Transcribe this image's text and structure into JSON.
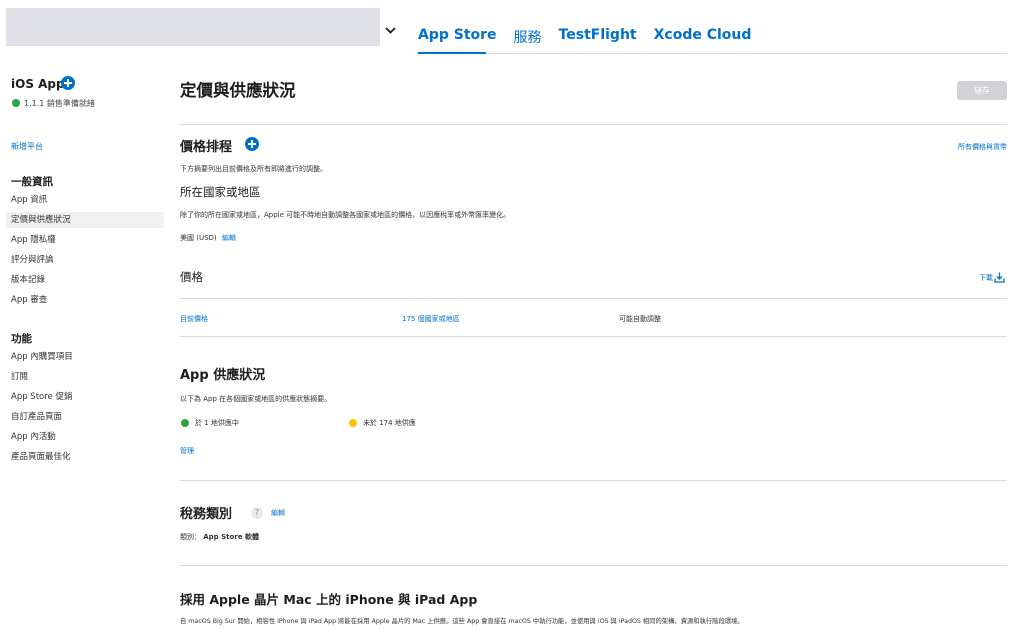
{
  "header": {
    "tabs": [
      {
        "label": "App Store",
        "active": true
      },
      {
        "label": "服務",
        "active": false
      },
      {
        "label": "TestFlight",
        "active": false
      },
      {
        "label": "Xcode Cloud",
        "active": false
      }
    ]
  },
  "sidebar": {
    "app_name": "iOS App",
    "status": "1.1.1 銷售準備就緒",
    "add_platform": "新增平台",
    "general_heading": "一般資訊",
    "general_items": [
      "App 資訊",
      "定價與供應狀況",
      "App 隱私權",
      "評分與評論",
      "版本記錄",
      "App 審查"
    ],
    "features_heading": "功能",
    "features_items": [
      "App 內購買項目",
      "訂閱",
      "App Store 促銷",
      "自訂產品頁面",
      "App 內活動",
      "產品頁面最佳化"
    ]
  },
  "main": {
    "title": "定價與供應狀況",
    "save_label": "儲存",
    "schedule": {
      "title": "價格排程",
      "all_prices_link": "所有價格與貨幣",
      "desc": "下方摘要列出目前價格及所有即將進行的調整。",
      "base_region_title": "所在國家或地區",
      "base_region_desc": "除了你的所在國家或地區，Apple 可能不時地自動調整各國家或地區的價格，以因應稅率或外幣匯率變化。",
      "currency": "美國 (USD)",
      "edit_label": "編輯"
    },
    "price": {
      "title": "價格",
      "download_label": "下載",
      "current_price_label": "目前價格",
      "regions_link": "175 個國家或地區",
      "auto_adjust": "可能自動調整"
    },
    "availability": {
      "title": "App 供應狀況",
      "desc": "以下為 App 在各個國家或地區的供應狀態摘要。",
      "available": "於 1 地供應中",
      "unavailable": "未於 174 地供應",
      "manage_label": "管理"
    },
    "tax": {
      "title": "稅務類別",
      "help": "?",
      "edit_label": "編輯",
      "category_label": "類別：",
      "category_value": "App Store 軟體"
    },
    "mac": {
      "title": "採用 Apple 晶片 Mac 上的 iPhone 與 iPad App",
      "desc": "自 macOS Big Sur 開始，相容性 iPhone 與 iPad App 將能在採用 Apple 晶片的 Mac 上供應。這些 App 會直接在 macOS 中執行功能，並使用與 iOS 與 iPadOS 相同的架構、資源和執行階段環境。"
    }
  },
  "colors": {
    "accent": "#0070c9",
    "success": "#27a744",
    "warning": "#ffc107",
    "divider": "#d9d9dc"
  }
}
